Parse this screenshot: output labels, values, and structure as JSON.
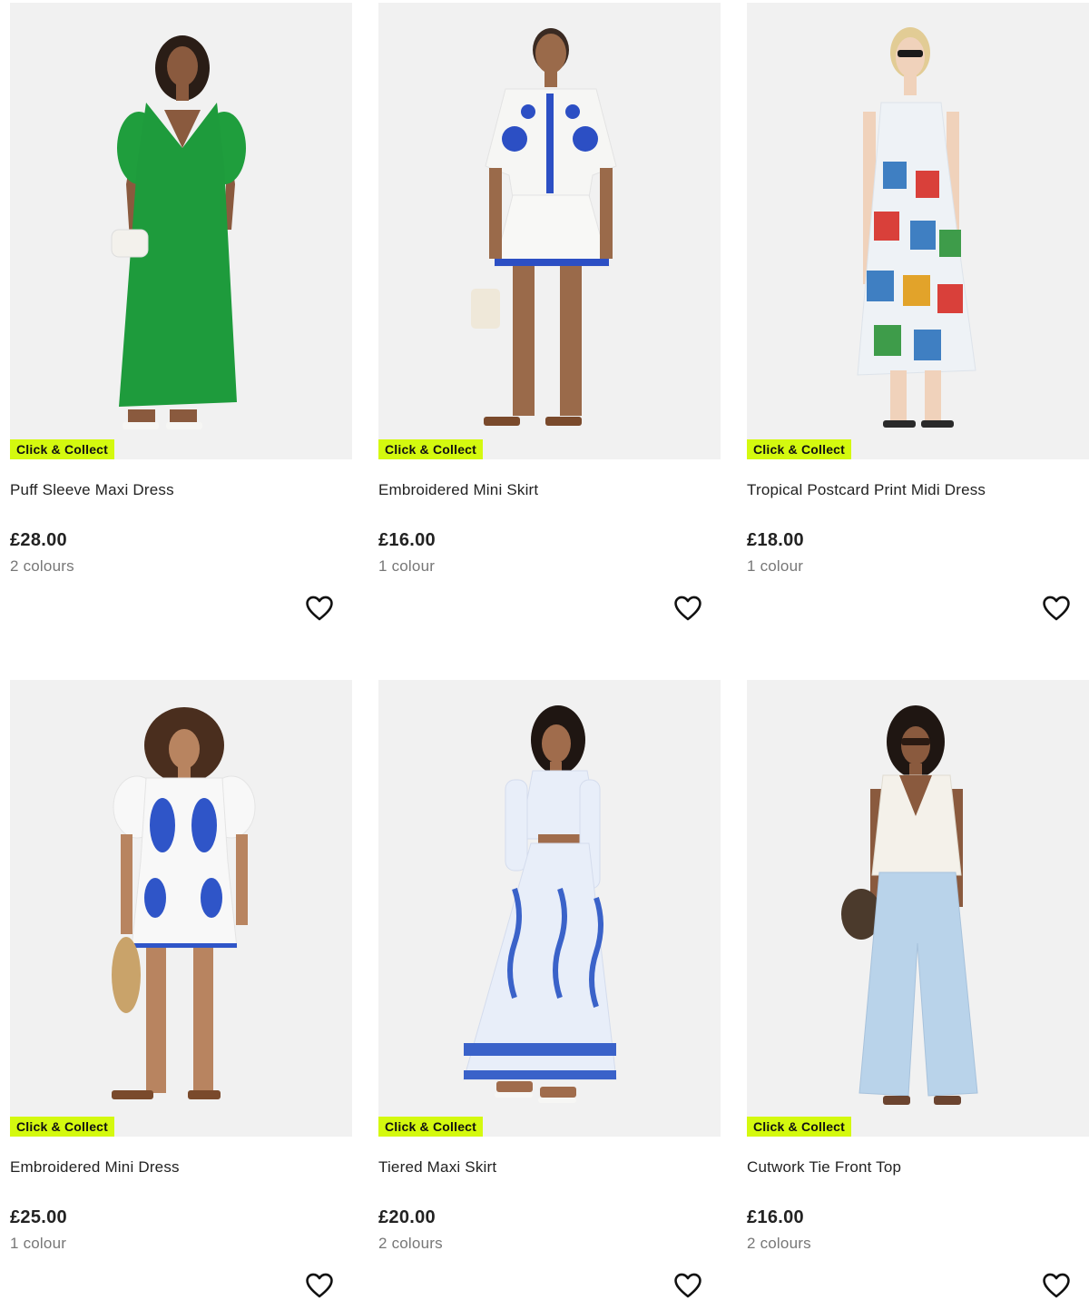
{
  "products": [
    {
      "title": "Puff Sleeve Maxi Dress",
      "price": "£28.00",
      "colours": "2 colours",
      "badge": "Click & Collect",
      "garment_color": "#1e9b3c",
      "style": "maxi-dress"
    },
    {
      "title": "Embroidered Mini Skirt",
      "price": "£16.00",
      "colours": "1 colour",
      "badge": "Click & Collect",
      "garment_color": "#f6f6f4",
      "accent_color": "#2c4fc4",
      "style": "set"
    },
    {
      "title": "Tropical Postcard Print Midi Dress",
      "price": "£18.00",
      "colours": "1 colour",
      "badge": "Click & Collect",
      "garment_color": "#eef2f6",
      "accent_color": "#d9403a",
      "style": "midi-dress"
    },
    {
      "title": "Embroidered Mini Dress",
      "price": "£25.00",
      "colours": "1 colour",
      "badge": "Click & Collect",
      "garment_color": "#f8f8f8",
      "accent_color": "#2f55c8",
      "style": "mini-dress"
    },
    {
      "title": "Tiered Maxi Skirt",
      "price": "£20.00",
      "colours": "2 colours",
      "badge": "Click & Collect",
      "garment_color": "#e8eef9",
      "accent_color": "#3a62c9",
      "style": "maxi-skirt"
    },
    {
      "title": "Cutwork Tie Front Top",
      "price": "£16.00",
      "colours": "2 colours",
      "badge": "Click & Collect",
      "garment_color": "#f4f1ea",
      "accent_color": "#b9d3ea",
      "style": "top-jeans"
    }
  ],
  "icons": {
    "wishlist": "heart-outline-icon"
  },
  "colors": {
    "badge_bg": "#d4f90f",
    "photo_bg": "#f1f1f1",
    "text": "#222222",
    "muted": "#777777"
  }
}
